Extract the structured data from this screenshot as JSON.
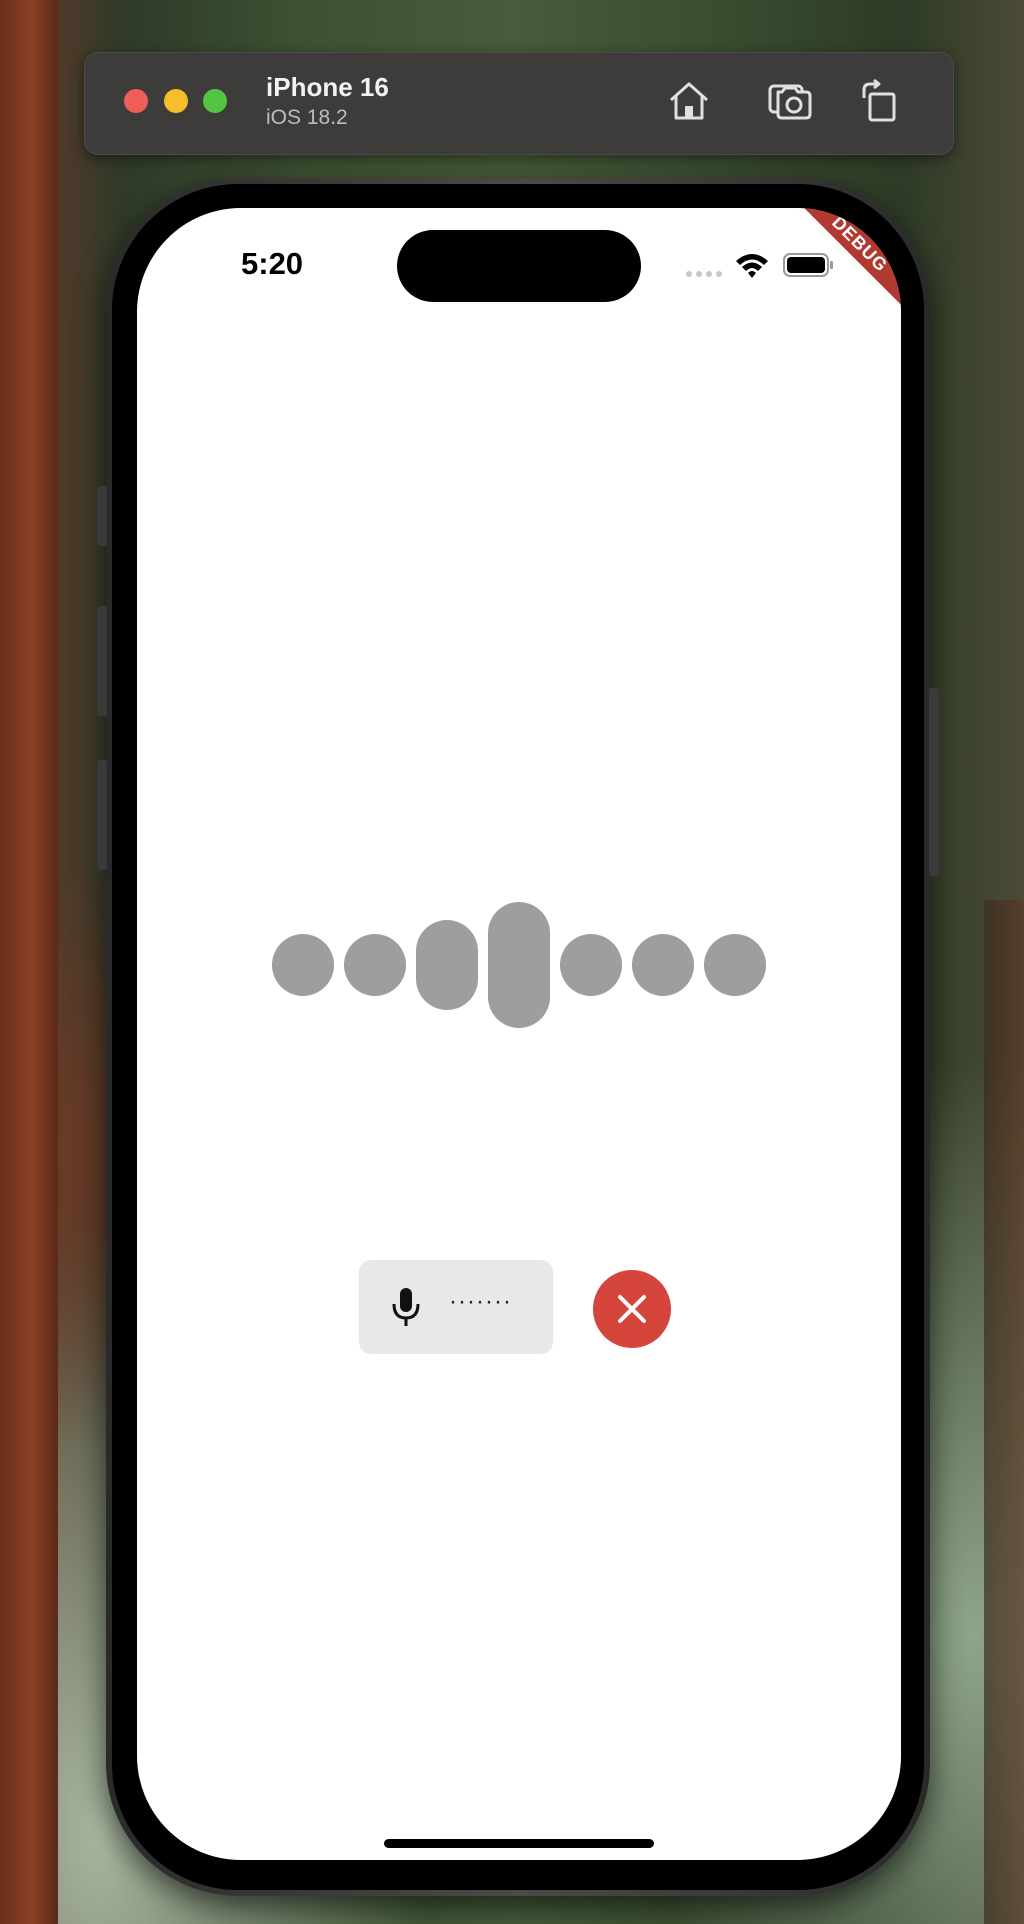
{
  "simulator": {
    "device_name": "iPhone 16",
    "os_version": "iOS 18.2",
    "toolbar_icons": [
      "home-icon",
      "screenshot-icon",
      "rotate-icon"
    ]
  },
  "status_bar": {
    "time": "5:20",
    "icons": [
      "signal-icon",
      "wifi-icon",
      "battery-icon"
    ]
  },
  "debug_banner": "DEBUG",
  "waveform": {
    "bar_count": 7,
    "color": "#9e9e9e"
  },
  "recorder": {
    "text": "·······",
    "mic_icon": "mic-icon"
  },
  "close_button": {
    "icon": "close-icon",
    "color": "#d5453b"
  }
}
